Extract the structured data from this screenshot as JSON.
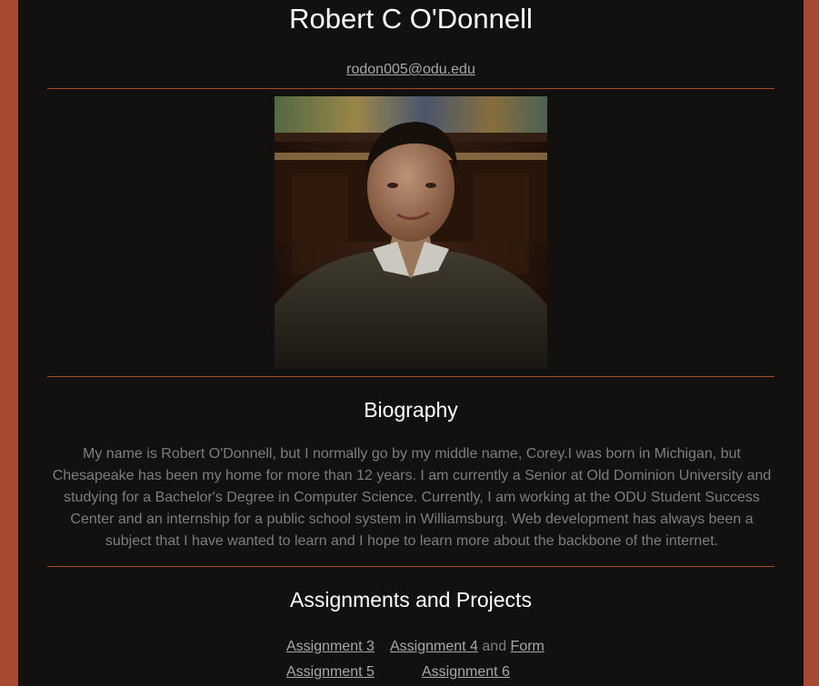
{
  "profile": {
    "name": "Robert C O'Donnell",
    "email": "rodon005@odu.edu"
  },
  "biography": {
    "heading": "Biography",
    "text": "My name is Robert O'Donnell, but I normally go by my middle name, Corey.I was born in Michigan, but Chesapeake has been my home for more than 12 years. I am currently a Senior at Old Dominion University and studying for a Bachelor's Degree in Computer Science. Currently, I am working at the ODU Student Success Center and an internship for a public school system in Williamsburg. Web development has always been a subject that I have wanted to learn and I hope to learn more about the backbone of the internet."
  },
  "assignments": {
    "heading": "Assignments and Projects",
    "links": {
      "assignment_3": "Assignment 3",
      "assignment_4": "Assignment 4",
      "and": "and",
      "form": "Form",
      "assignment_5": "Assignment 5",
      "assignment_6": "Assignment 6"
    }
  },
  "colors": {
    "background": "#a84a32",
    "panel": "#121110",
    "rule": "#a84a32",
    "heading": "#ffffff",
    "body_text": "#7d7d7d",
    "link": "#a8a8a8"
  }
}
